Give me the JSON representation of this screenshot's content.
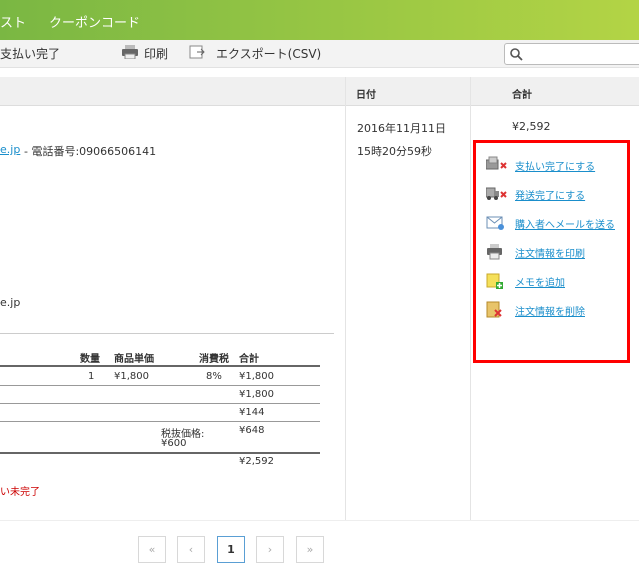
{
  "nav": {
    "item1": "スト",
    "item2": "クーポンコード"
  },
  "toolbar": {
    "status": "支払い完了",
    "print": "印刷",
    "export": "エクスポート(CSV)"
  },
  "table": {
    "col_date": "日付",
    "col_total": "合計"
  },
  "order": {
    "email_suffix": "e.jp",
    "phone_text": "- 電話番号:09066506141",
    "email_suffix2": "e.jp",
    "date": "2016年11月11日",
    "time": "15時20分59秒",
    "total": "¥2,592"
  },
  "actions": [
    {
      "label": "支払い完了にする",
      "icon": "payment-icon"
    },
    {
      "label": "発送完了にする",
      "icon": "truck-icon"
    },
    {
      "label": "購入者へメールを送る",
      "icon": "mail-icon"
    },
    {
      "label": "注文情報を印刷",
      "icon": "printer-icon"
    },
    {
      "label": "メモを追加",
      "icon": "memo-add-icon"
    },
    {
      "label": "注文情報を削除",
      "icon": "delete-icon"
    }
  ],
  "items": {
    "headers": [
      "数量",
      "商品単価",
      "消費税",
      "合計"
    ],
    "qty": "1",
    "unit_price": "¥1,800",
    "tax_rate": "8%",
    "line_total": "¥1,800",
    "subtotal": "¥1,800",
    "tax": "¥144",
    "taxfree_label": "税抜価格:",
    "taxfree_value": "¥600",
    "taxfree_right": "¥648",
    "grand_total": "¥2,592",
    "payment_status": "い未完了"
  },
  "pager": {
    "first": "«",
    "prev": "‹",
    "current": "1",
    "next": "›",
    "last": "»"
  },
  "colors": {
    "accent": "#8bc34a",
    "link": "#1a8ecb",
    "highlight": "#ff0000",
    "warning": "#cc0000"
  }
}
